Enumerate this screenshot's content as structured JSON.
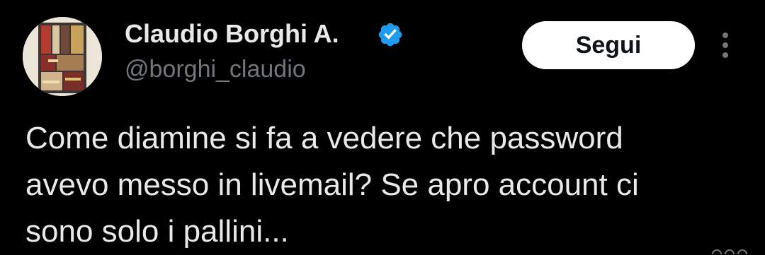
{
  "colors": {
    "background": "#000000",
    "primary_text": "#e7e9ea",
    "secondary_text": "#71767b",
    "verified_badge": "#1d9bf0",
    "follow_button_bg": "#ffffff",
    "follow_button_text": "#0f1419"
  },
  "author": {
    "name": "Claudio Borghi A.",
    "handle": "@borghi_claudio",
    "verified_icon": "verified-badge-icon",
    "avatar_icon": "avatar"
  },
  "actions": {
    "follow_label": "Segui",
    "more_icon": "more-vertical-icon"
  },
  "tweet": {
    "lines": [
      "Come diamine si fa a vedere che password",
      "avevo messo in livemail? Se apro account ci",
      "sono solo i pallini..."
    ]
  }
}
